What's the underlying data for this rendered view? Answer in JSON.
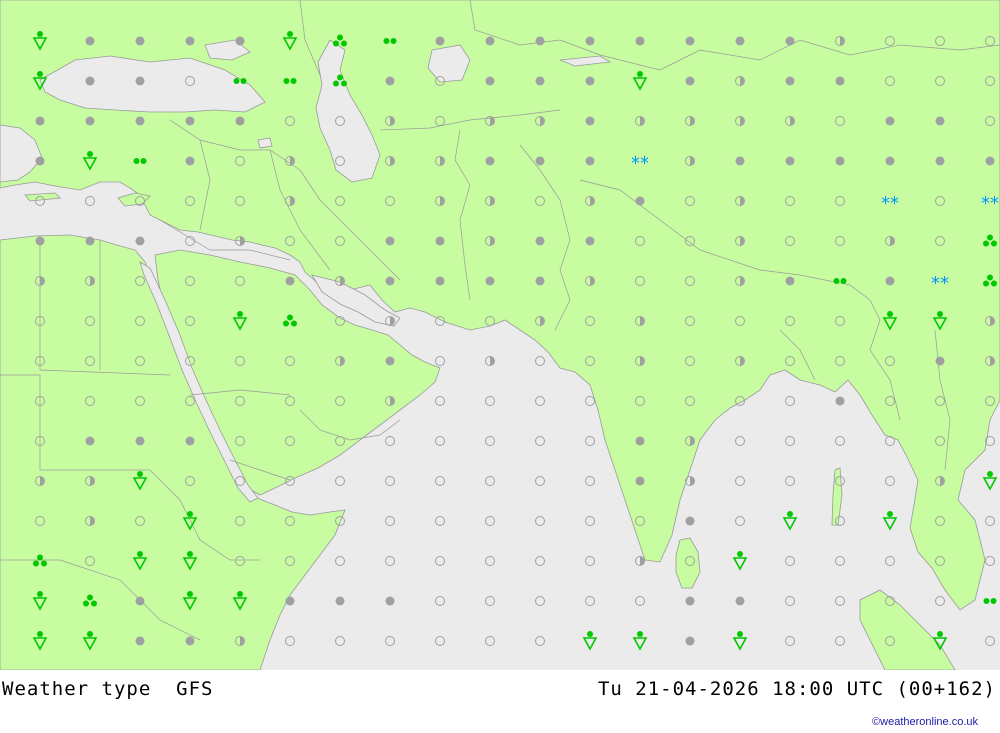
{
  "title": "Weather type",
  "model": "GFS",
  "valid_time": "Tu 21-04-2026 18:00 UTC (00+162)",
  "credit": "©weatheronline.co.uk",
  "colors": {
    "land": "#c8fca0",
    "sea": "#ebebeb",
    "border": "#9a9a9a",
    "cloud": "#a0a0a0",
    "rain": "#00c800",
    "snow": "#0096ff"
  },
  "symbol_legend": {
    "overcast": "filled-circle",
    "cloudy": "half-circle",
    "clear": "open-circle",
    "showers": "shower-icon",
    "drizzle": "drizzle-icon",
    "rain": "rain-icon",
    "snow": "snow-icon"
  },
  "grid": {
    "cols": 20,
    "rows": 16,
    "symbols": [
      "SFFFFSRDFFFFFFFFHOOO",
      "SFFODDRFOFFFSFHFFOOO",
      "FFFFFOOHOHHFHHHHOFFO",
      "FSDFOHOHHFFFXHFFFFFF",
      "OOOOOHOOHHOHFOHOOXOX",
      "FFFOHOOFFHFFOOHOOHOR",
      "HHOOOFHFFFFHOOHFDFXR",
      "OOOOSROHOOHOHOOOOSSH",
      "OOOOOOHFOHOOHOHOOOFH",
      "OOOOOOOHOOOOOOOOFOOO",
      "OFFFOOOOOOOOFHOOOOOO",
      "HHSOOOOOOOOOFHOOOOHS",
      "OHOSOOOOOOOOOFOSOSOO",
      "ROSSOOOOOOOOHOSOOOOO",
      "SRFSSFFFOOOOOFFOOOOD",
      "SSFFHOOOOOOSSFSOOOSO"
    ]
  }
}
